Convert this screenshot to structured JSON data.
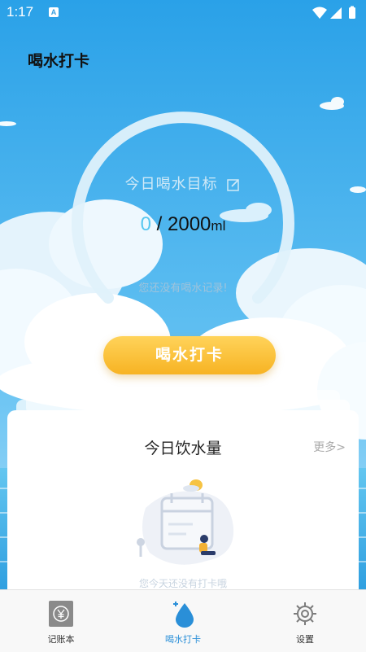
{
  "status_bar": {
    "time": "1:17",
    "notification_letter": "A"
  },
  "header": {
    "title": "喝水打卡"
  },
  "goal": {
    "label": "今日喝水目标",
    "current_amount": "0",
    "separator": " / ",
    "target_amount": "2000",
    "unit": "ml",
    "progress": 0,
    "empty_message": "您还没有喝水记录!"
  },
  "checkin_button": {
    "label": "喝水打卡"
  },
  "today_card": {
    "title": "今日饮水量",
    "more_label": "更多>",
    "empty_text": "您今天还没有打卡哦"
  },
  "tabbar": {
    "items": [
      {
        "label": "记账本",
        "icon": "yen-icon",
        "active": false
      },
      {
        "label": "喝水打卡",
        "icon": "water-drop-icon",
        "active": true
      },
      {
        "label": "设置",
        "icon": "gear-icon",
        "active": false
      }
    ]
  },
  "colors": {
    "sky": "#2fa6ea",
    "accent": "#58c7f0",
    "button": "#f7b323",
    "active_tab": "#2a8fd8"
  }
}
